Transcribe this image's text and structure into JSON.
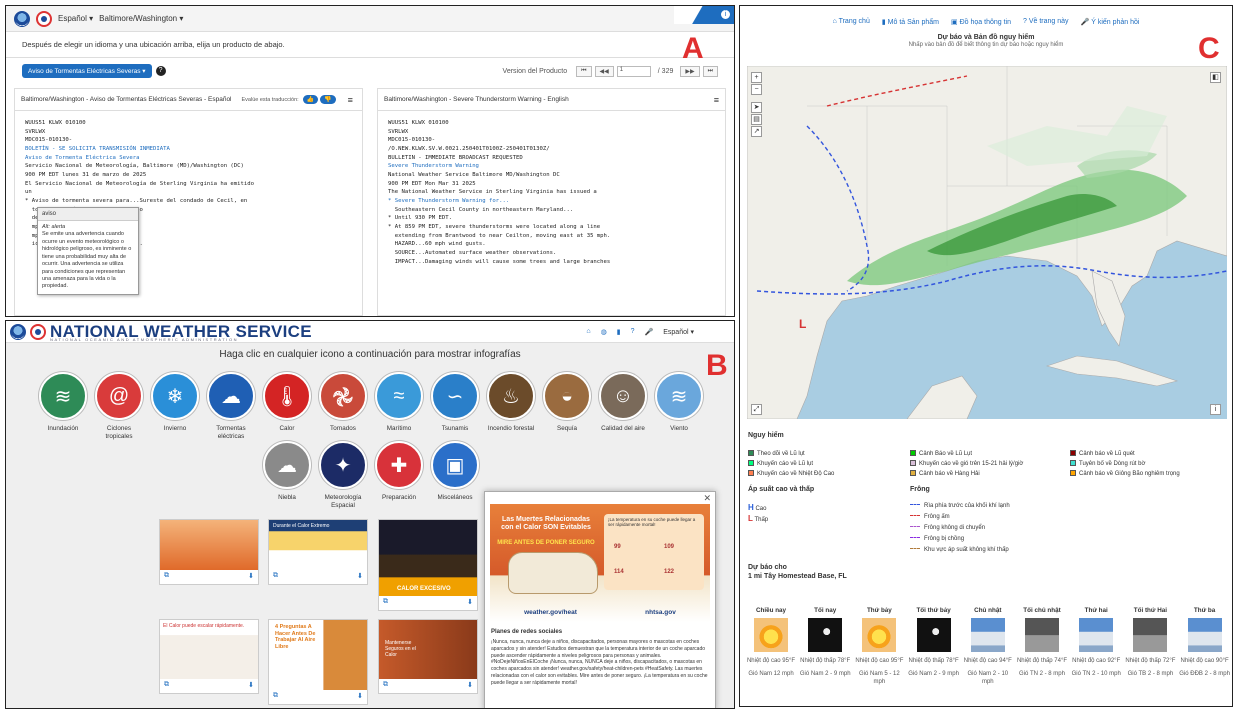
{
  "panel_a": {
    "letter": "A",
    "language": "Español",
    "location": "Baltimore/Washington",
    "instruction": "Después de elegir un idioma y una ubicación arriba, elija un producto de abajo.",
    "product_button": "Aviso de Tormentas Eléctricas Severas",
    "help": "?",
    "version_label": "Version del Producto",
    "pager_first": "⏮",
    "pager_prev": "◀◀",
    "page_value": "1",
    "page_total": "/ 329",
    "pager_next": "▶▶",
    "pager_last": "⏭",
    "left_title": "Baltimore/Washington - Aviso de Tormentas Eléctricas Severas - Español",
    "eval_label": "Evalúe esta traducción:",
    "thumb_up": "👍",
    "thumb_down": "👎",
    "menu": "≡",
    "right_title": "Baltimore/Washington - Severe Thunderstorm Warning - English",
    "left_text": [
      "WUUS51 KLWX 010100",
      "SVRLWX",
      "MDC015-010130-",
      "",
      "BOLETÍN - SE SOLICITA TRANSMISIÓN INMEDIATA",
      "Aviso de Tormenta Eléctrica Severa",
      "Servicio Nacional de Meteorología, Baltimore (MD)/Washington (DC)",
      "900 PM EDT lunes 31 de marzo de 2025",
      "",
      "El Servicio Nacional de Meteorología de Sterling Virginia ha emitido",
      "un",
      "",
      "* Aviso de tormenta severa para...Sureste del condado de Cecil, en",
      "",
      "",
      "",
      "",
      "  tormentas eléctricas severas a lo",
      "  desde Brantwood hasta cerca de",
      "  mph.",
      "",
      "",
      "",
      "  mph.",
      "",
      "",
      "  icas de superficie automatizadas."
    ],
    "tooltip_title": "aviso",
    "tooltip_sub": "Alt: alerta",
    "tooltip_body": "Se emite una advertencia cuando ocurre un evento meteorológico o hidrológico peligroso, es inminente o tiene una probabilidad muy alta de ocurrir. Una advertencia se utiliza para condiciones que representan una amenaza para la vida o la propiedad.",
    "right_text": [
      "WUUS51 KLWX 010100",
      "SVRLWX",
      "MDC015-010130-",
      "/O.NEW.KLWX.SV.W.0021.250401T0100Z-250401T0130Z/",
      "",
      "BULLETIN - IMMEDIATE BROADCAST REQUESTED",
      "Severe Thunderstorm Warning",
      "National Weather Service Baltimore MD/Washington DC",
      "900 PM EDT Mon Mar 31 2025",
      "",
      "The National Weather Service in Sterling Virginia has issued a",
      "",
      "* Severe Thunderstorm Warning for...",
      "  Southeastern Cecil County in northeastern Maryland...",
      "",
      "* Until 930 PM EDT.",
      "",
      "* At 859 PM EDT, severe thunderstorms were located along a line",
      "  extending from Brantwood to near Ceilton, moving east at 35 mph.",
      "",
      "  HAZARD...60 mph wind gusts.",
      "",
      "  SOURCE...Automated surface weather observations.",
      "",
      "  IMPACT...Damaging winds will cause some trees and large branches"
    ]
  },
  "panel_b": {
    "letter": "B",
    "brand": "NATIONAL WEATHER SERVICE",
    "brand_sub": "NATIONAL OCEANIC AND ATMOSPHERIC ADMINISTRATION",
    "nav_language": "Español",
    "heading": "Haga clic en cualquier icono a continuación para mostrar infografías",
    "icons_row1": [
      {
        "label": "Inundación",
        "color": "#2e8b57",
        "glyph": "≋"
      },
      {
        "label": "Ciclones tropicales",
        "color": "#d93b3b",
        "glyph": "@"
      },
      {
        "label": "Invierno",
        "color": "#2a8fd8",
        "glyph": "❄"
      },
      {
        "label": "Tormentas eléctricas",
        "color": "#1f5fb4",
        "glyph": "☁"
      },
      {
        "label": "Calor",
        "color": "#d42424",
        "glyph": "🌡"
      },
      {
        "label": "Tornados",
        "color": "#c94a3a",
        "glyph": "𖣘"
      },
      {
        "label": "Marítimo",
        "color": "#3a9ad9",
        "glyph": "≈"
      },
      {
        "label": "Tsunamis",
        "color": "#2a7fc9",
        "glyph": "∽"
      },
      {
        "label": "Incendio forestal",
        "color": "#6b4b2a",
        "glyph": "♨"
      },
      {
        "label": "Sequía",
        "color": "#9a6b3f",
        "glyph": "◒"
      },
      {
        "label": "Calidad del aire",
        "color": "#7a6a5a",
        "glyph": "☺"
      },
      {
        "label": "Viento",
        "color": "#6aa7dc",
        "glyph": "≋"
      }
    ],
    "icons_row2": [
      {
        "label": "Niebla",
        "color": "#8a8a8a",
        "glyph": "☁"
      },
      {
        "label": "Meteorología Espacial",
        "color": "#1c2b66",
        "glyph": "✦"
      },
      {
        "label": "Preparación",
        "color": "#d8323a",
        "glyph": "✚"
      },
      {
        "label": "Misceláneos",
        "color": "#2b6fc9",
        "glyph": "▣"
      }
    ],
    "card_texts": [
      {
        "title": "Durante el Calor Extremo"
      },
      {
        "title": "CALOR EXCESIVO"
      },
      {
        "title": "El Calor puede escalar rápidamente."
      },
      {
        "title": "4 Preguntas A Hacer Antes De Trabajar Al Aire Libre"
      },
      {
        "title": "Mantenerse Seguros en el Calor"
      }
    ],
    "card_open": "⧉",
    "card_download": "⬇",
    "modal_close": "✕",
    "poster_title": "Las Muertes Relacionadas con el Calor SON Evitables",
    "poster_sub": "MIRE ANTES DE PONER SEGURO",
    "poster_temp_title": "¡La temperatura en su coche puede llegar a ser rápidamente mortal!",
    "poster_temps": [
      "99",
      "109",
      "114",
      "122"
    ],
    "poster_url1": "weather.gov/heat",
    "poster_url2": "nhtsa.gov",
    "social_title": "Planes de redes sociales",
    "social_text": "¡Nunca, nunca, nunca deje a niños, discapacitados, personas mayores o mascotas en coches aparcados y sin atender! Estudios demuestran que la temperatura interior de un coche aparcado puede ascender rápidamente a niveles peligrosos para personas y animales. #NoDejeNiñosEnElCoche ¡Nunca, nunca, NUNCA deje a niños, discapacitados, o mascotas en coches aparcados sin atender! weather.gov/safety/heat-children-pets #HeatSafety. Las muertes relacionadas con el calor son evitables. Mire antes de poner seguro. ¡La temperatura en su coche puede llegar a ser rápidamente mortal!"
  },
  "panel_c": {
    "letter": "C",
    "nav": [
      "Trang chủ",
      "Mô tả Sản phẩm",
      "Đồ họa thông tin",
      "Về trang này",
      "Ý kiến phản hồi"
    ],
    "title": "Dự báo và Bản đồ nguy hiểm",
    "subtitle": "Nhấp vào bản đồ để biết thông tin dự báo hoặc nguy hiểm",
    "map_zoom_in": "+",
    "map_zoom_out": "−",
    "map_info": "i",
    "map_l_marker": "L",
    "hazards_title": "Nguy hiểm",
    "hazards": [
      {
        "label": "Theo dõi về Lũ lụt",
        "color": "#2e8b57"
      },
      {
        "label": "Khuyến cáo về Lũ lụt",
        "color": "#00ff7f"
      },
      {
        "label": "Khuyến cáo về Nhiệt Độ Cao",
        "color": "#ff7f50"
      },
      {
        "label": "Cảnh Báo về Lũ Lụt",
        "color": "#00cc00"
      },
      {
        "label": "Khuyến cáo về gió trên 15-21 hải lý/giờ",
        "color": "#d8bfd8"
      },
      {
        "label": "Cảnh báo về Hàng Hải",
        "color": "#e0b040"
      },
      {
        "label": "Cảnh báo về Lũ quét",
        "color": "#8b0000"
      },
      {
        "label": "Tuyên bố về Dòng rút bờ",
        "color": "#40e0d0"
      },
      {
        "label": "Cảnh báo về Giông Bão nghiêm trọng",
        "color": "#ffa500"
      }
    ],
    "pressure_title": "Áp suất cao và thấp",
    "high_label": "Cao",
    "high_letter": "H",
    "low_label": "Thấp",
    "low_letter": "L",
    "fronts_title": "Frông",
    "fronts": [
      "Rìa phía trước của khối khí lạnh",
      "Frông ấm",
      "Frông không di chuyển",
      "Frông bị chồng",
      "Khu vực áp suất không khí thấp"
    ],
    "forecast_title": "Dự báo cho",
    "forecast_location": "1 mi Tây Homestead Base, FL",
    "forecast": [
      {
        "day": "Chiều nay",
        "temp": "Nhiệt độ cao 95°F",
        "wind": "Gió Nam 12 mph",
        "kind": "sun"
      },
      {
        "day": "Tối nay",
        "temp": "Nhiệt độ thấp 78°F",
        "wind": "Gió Nam 2 - 9 mph",
        "kind": "night"
      },
      {
        "day": "Thứ bảy",
        "temp": "Nhiệt độ cao 95°F",
        "wind": "Gió Nam 5 - 12 mph",
        "kind": "sun"
      },
      {
        "day": "Tối thứ bảy",
        "temp": "Nhiệt độ thấp 78°F",
        "wind": "Gió Nam 2 - 9 mph",
        "kind": "night"
      },
      {
        "day": "Chủ nhật",
        "temp": "Nhiệt độ cao 94°F",
        "wind": "Gió Nam 2 - 10 mph",
        "kind": "cloud"
      },
      {
        "day": "Tối chủ nhật",
        "temp": "Nhiệt độ thấp 74°F",
        "wind": "Gió TN 2 - 8 mph",
        "kind": "storm"
      },
      {
        "day": "Thứ hai",
        "temp": "Nhiệt độ cao 92°F",
        "wind": "Gió TN 2 - 10 mph",
        "kind": "cloud"
      },
      {
        "day": "Tối thứ Hai",
        "temp": "Nhiệt độ thấp 72°F",
        "wind": "Gió TB 2 - 8 mph",
        "kind": "storm"
      },
      {
        "day": "Thứ ba",
        "temp": "Nhiệt độ cao 90°F",
        "wind": "Gió ĐĐB 2 - 8 mph",
        "kind": "cloud"
      }
    ]
  },
  "colors": {
    "accent": "#1e6dbf",
    "panel_letter": "#e03030",
    "nws_navy": "#1c3f80",
    "map_water": "#a9cde2",
    "map_land": "#f0efe9"
  }
}
